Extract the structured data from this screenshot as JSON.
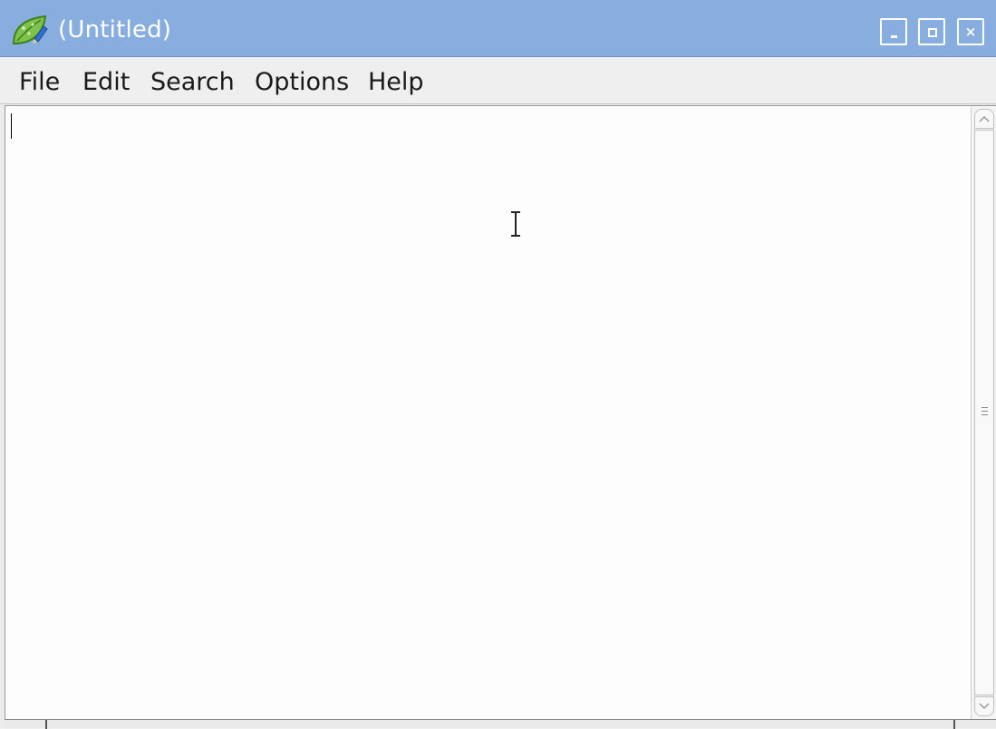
{
  "window": {
    "title": "(Untitled)",
    "app_icon": "leafpad-icon",
    "controls": {
      "minimize_icon": "minimize-icon",
      "maximize_icon": "maximize-icon",
      "close_icon": "close-icon",
      "close_glyph": "×"
    },
    "titlebar_color": "#87aede"
  },
  "menubar": {
    "items": [
      {
        "label": "File"
      },
      {
        "label": "Edit"
      },
      {
        "label": "Search"
      },
      {
        "label": "Options"
      },
      {
        "label": "Help"
      }
    ]
  },
  "editor": {
    "text": "",
    "cursor_icon": "ibeam-cursor-icon"
  },
  "scrollbar": {
    "up_icon": "scroll-up-arrow-icon",
    "down_icon": "scroll-down-arrow-icon",
    "grip_icon": "scroll-grip-icon"
  }
}
